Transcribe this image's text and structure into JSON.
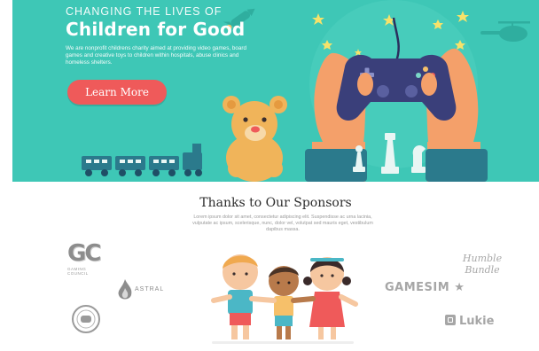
{
  "hero": {
    "kicker": "CHANGING THE LIVES OF",
    "title": "Children for Good",
    "description": "We are nonprofit childrens charity aimed at providing video games, board games and creative toys to children within hospitals, abuse clinics and homeless shelters.",
    "cta_label": "Learn More"
  },
  "sponsors": {
    "title": "Thanks to Our Sponsors",
    "description": "Lorem ipsum dolor sit amet, consectetur adipiscing elit. Suspendisse ac urna lacinia, vulputate ac ipsum, scelerisque, nunc, dolor vel, volutpat sed mauris eget, vestibulum dapibus massa.",
    "logos": {
      "gc": {
        "mark": "GC",
        "caption": "GAMING COUNCIL"
      },
      "astral": {
        "name": "ASTRAL"
      },
      "humble": {
        "line1": "Humble",
        "line2": "Bundle"
      },
      "gamesim": {
        "name": "GAMESIM"
      },
      "lukie": {
        "name": "Lukie"
      }
    }
  },
  "colors": {
    "hero_bg": "#3ec7b6",
    "cta_bg": "#ef5a5a",
    "controller": "#3a3f7a",
    "hand": "#f4a06a"
  },
  "icons": [
    "game-controller-icon",
    "teddy-bear-icon",
    "chess-pieces-icon",
    "toy-train-icon",
    "rocket-icon",
    "helicopter-icon",
    "star-icon"
  ]
}
